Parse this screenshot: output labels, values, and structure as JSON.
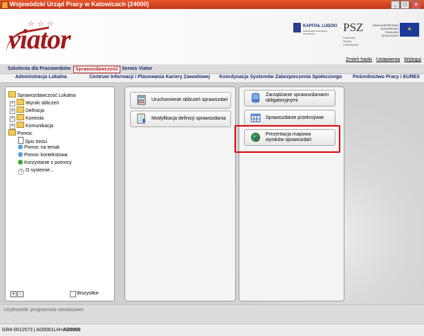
{
  "window": {
    "title": "Wojewódzki Urząd Pracy w Katowicach (24000)",
    "min": "_",
    "max": "□",
    "close": "×"
  },
  "banner": {
    "logo": "viator",
    "stars": "☆☆☆",
    "kapital": "KAPITAŁ LUDZKI",
    "kapital_sub": "NARODOWA STRATEGIA SPÓJNOŚCI",
    "psz": "PSZ",
    "psz_sub": "Publiczne Służby Zatrudnienia",
    "ue": "UNIA EUROPEJSKA EUROPEJSKI FUNDUSZ SPOŁECZNY",
    "ue_flag": "★"
  },
  "toplinks": [
    "Zmień hasło",
    "Ustawienia",
    "Wyloguj"
  ],
  "tabs1": [
    "Szkolenia dla Pracowników",
    "Sprawozdawczość",
    "Serwis Viator"
  ],
  "tabs2": [
    "Administracja Lokalna",
    "Centrum Informacji i Planowania Kariery Zawodowej",
    "Koordynacja Systemów Zabezpieczenia Społecznego",
    "Pośrednictwo Pracy i EURES"
  ],
  "tree": {
    "root": "Sprawozdawczość Lokalna",
    "children": [
      "Wyniki obliczeń",
      "Definicja",
      "Kontrola",
      "Komunikacja"
    ],
    "help": "Pomoc",
    "help_items": [
      "Spis treści",
      "Pomoc na temat",
      "Pomoc kontekstowa",
      "Korzystanie z pomocy",
      "O systemie..."
    ],
    "expand_all": "+",
    "collapse_all": "-",
    "show_all": "Wszystkie"
  },
  "panel1": {
    "buttons": [
      "Uruchomienie obliczeń sprawozdań",
      "Modyfikacja definicji sprawozdania"
    ]
  },
  "panel2": {
    "btn1": [
      "Zarządzanie sprawozdaniami",
      "obligatoryjnymi"
    ],
    "btn2": "Sprawozdanie przekrojowe",
    "btn3": [
      "Prezentacja mapowa",
      "wyników sprawozdań"
    ]
  },
  "status": "Użytkownik: programista-serwisowiec",
  "bottom": {
    "left": "GR4-0012573 | AD0001LH>",
    "bold": "AD0000"
  }
}
